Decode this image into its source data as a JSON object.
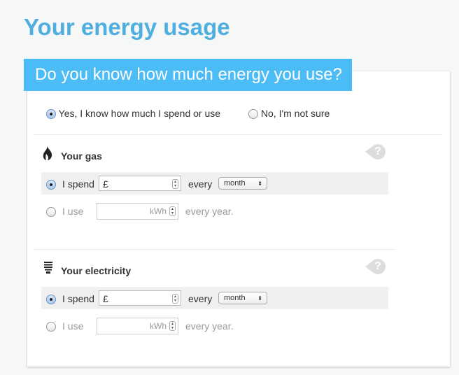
{
  "page_title": "Your energy usage",
  "question": "Do you know how much energy you use?",
  "options": [
    {
      "label": "Yes, I know how much I spend or use",
      "selected": true
    },
    {
      "label": "No, I'm not sure",
      "selected": false
    }
  ],
  "sections": [
    {
      "title": "Your gas",
      "icon": "flame-icon",
      "help": "?",
      "spend_label": "I spend",
      "currency": "£",
      "every": "every",
      "period": "month",
      "use_label": "I use",
      "unit": "kWh",
      "every_year": "every year.",
      "spend_selected": true
    },
    {
      "title": "Your electricity",
      "icon": "lightbulb-icon",
      "help": "?",
      "spend_label": "I spend",
      "currency": "£",
      "every": "every",
      "period": "month",
      "use_label": "I use",
      "unit": "kWh",
      "every_year": "every year.",
      "spend_selected": true
    }
  ],
  "colors": {
    "accent": "#4bbcf5",
    "title": "#4eaee0"
  }
}
